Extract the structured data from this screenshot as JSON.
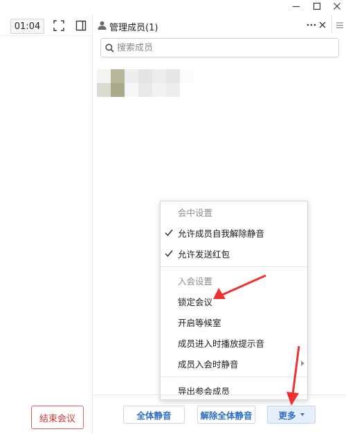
{
  "toolbar": {
    "timer": "01:04"
  },
  "members_panel": {
    "title": "管理成员(1)",
    "search_placeholder": "搜索成员"
  },
  "more_menu": {
    "in_meeting_header": "会中设置",
    "allow_self_unmute": "允许成员自我解除静音",
    "allow_red_packet": "允许发送红包",
    "join_header": "入会设置",
    "lock_meeting": "锁定会议",
    "waiting_room": "开启等候室",
    "join_sound": "成员进入时播放提示音",
    "mute_on_join": "成员入会时静音",
    "export_members": "导出参会成员"
  },
  "footer": {
    "end_meeting": "结束会议",
    "mute_all": "全体静音",
    "unmute_all": "解除全体静音",
    "more": "更多"
  },
  "colors": {
    "accent_blue": "#2b6cc4",
    "end_red": "#d9342f",
    "annotation_arrow": "#ee3030"
  },
  "icons": [
    "minimize-icon",
    "maximize-icon",
    "fullscreen-icon",
    "sidebar-layout-icon",
    "person-icon",
    "more-dots-icon",
    "close-icon",
    "hamburger-menu-icon",
    "search-icon",
    "checkmark-icon",
    "submenu-arrow-icon",
    "dropdown-caret-icon"
  ]
}
